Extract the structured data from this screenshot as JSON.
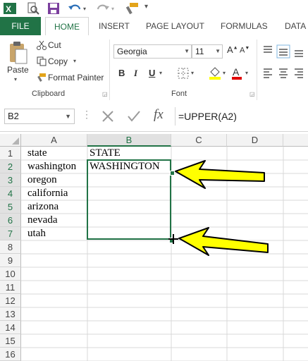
{
  "ribbon_tabs": [
    "FILE",
    "HOME",
    "INSERT",
    "PAGE LAYOUT",
    "FORMULAS",
    "DATA"
  ],
  "clipboard": {
    "paste": "Paste",
    "cut": "Cut",
    "copy": "Copy",
    "format_painter": "Format Painter",
    "group_label": "Clipboard"
  },
  "font": {
    "family": "Georgia",
    "size": "11",
    "bold": "B",
    "italic": "I",
    "underline": "U",
    "group_label": "Font",
    "highlight_color": "#ffff00",
    "font_color": "#e00000"
  },
  "formula_bar": {
    "name_box": "B2",
    "fx": "fx",
    "formula": "=UPPER(A2)"
  },
  "columns": [
    "A",
    "B",
    "C",
    "D"
  ],
  "rows": [
    "1",
    "2",
    "3",
    "4",
    "5",
    "6",
    "7",
    "8",
    "9",
    "10",
    "11",
    "12",
    "13",
    "14",
    "15",
    "16"
  ],
  "cells": {
    "A1": "state",
    "A2": "washington",
    "A3": "oregon",
    "A4": "california",
    "A5": "arizona",
    "A6": "nevada",
    "A7": "utah",
    "B1": "STATE",
    "B2": "WASHINGTON"
  },
  "colors": {
    "excel_green": "#217346",
    "selection_border": "#217346",
    "arrow_fill": "#ffff00"
  },
  "icons": [
    "excel-logo-icon",
    "print-preview-icon",
    "save-icon",
    "undo-icon",
    "redo-icon",
    "format-painter-icon",
    "cut-icon",
    "copy-icon",
    "paste-icon",
    "fill-color-icon",
    "font-color-icon",
    "borders-icon",
    "align-icon",
    "cancel-icon",
    "enter-icon",
    "fill-handle-cursor-icon",
    "callout-arrow-icon"
  ]
}
